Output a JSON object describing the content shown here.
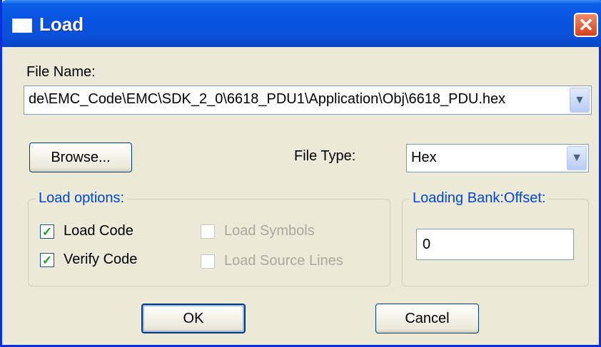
{
  "window": {
    "title": "Load",
    "close_glyph": "✕"
  },
  "file_name": {
    "label": "File Name:",
    "value": "de\\EMC_Code\\EMC\\SDK_2_0\\6618_PDU1\\Application\\Obj\\6618_PDU.hex"
  },
  "browse": {
    "label": "Browse..."
  },
  "file_type": {
    "label": "File Type:",
    "value": "Hex"
  },
  "load_options": {
    "legend": "Load options:",
    "items": [
      {
        "label": "Load Code",
        "checked": true,
        "enabled": true
      },
      {
        "label": "Verify Code",
        "checked": true,
        "enabled": true
      },
      {
        "label": "Load Symbols",
        "checked": false,
        "enabled": false
      },
      {
        "label": "Load Source Lines",
        "checked": false,
        "enabled": false
      }
    ]
  },
  "loading_bank": {
    "legend": "Loading Bank:Offset:",
    "value": "0"
  },
  "buttons": {
    "ok": "OK",
    "cancel": "Cancel"
  },
  "icons": {
    "dropdown": "chevron-down-icon",
    "check": "checkmark-icon",
    "close": "close-icon",
    "window": "window-icon"
  },
  "colors": {
    "titlebar": "#0754e2",
    "dialog_bg": "#ece9d8",
    "groupbox_text": "#0046d5",
    "check_green": "#21a121",
    "close_red": "#d4421c",
    "disabled_text": "#aca899"
  }
}
